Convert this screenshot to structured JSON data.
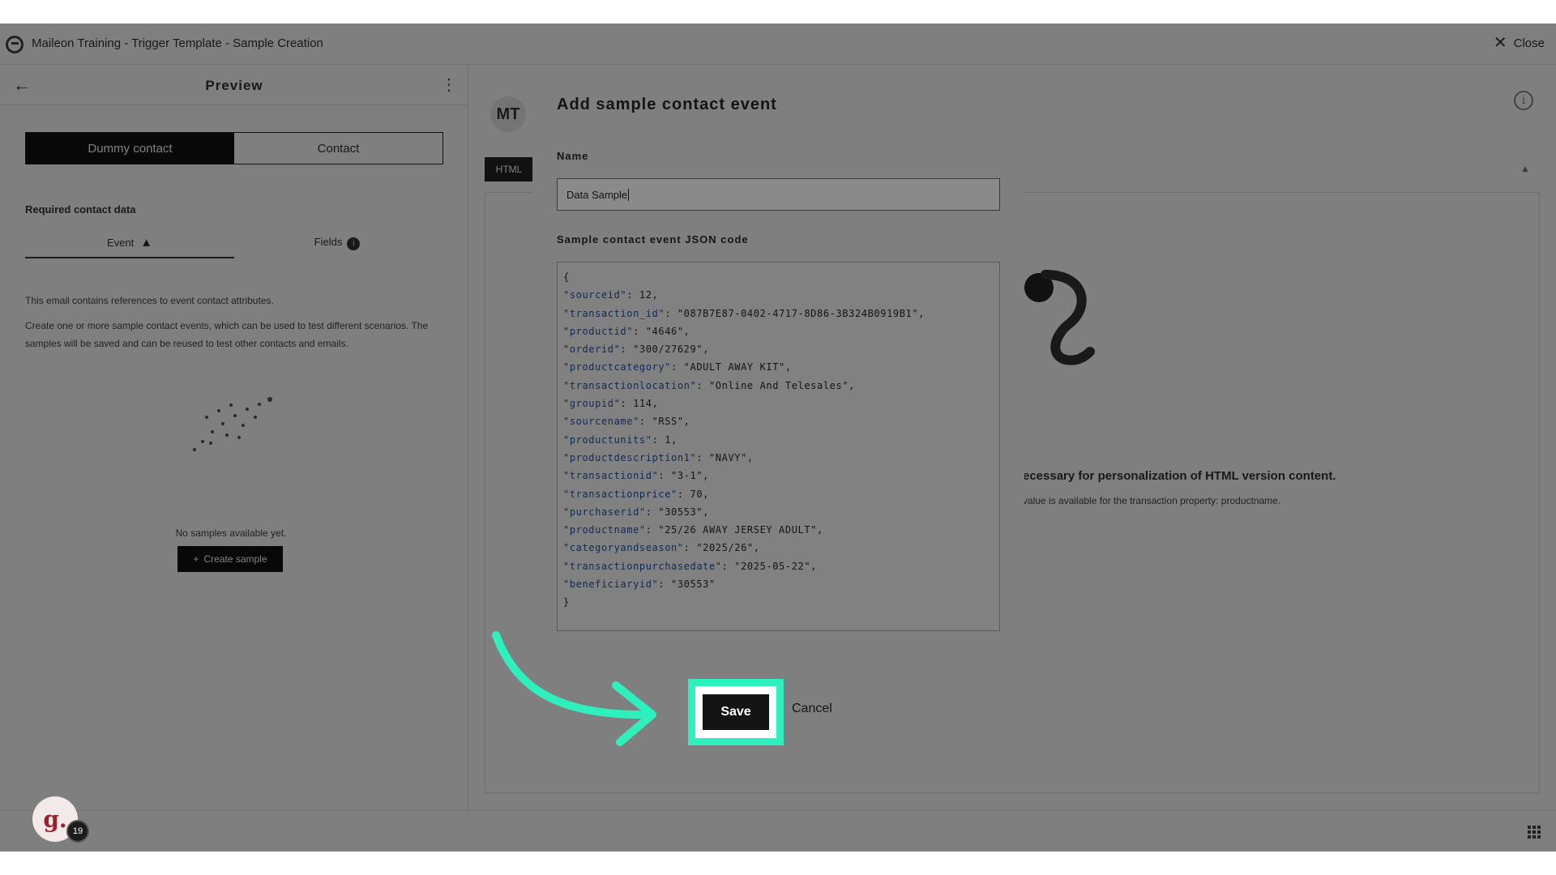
{
  "app": {
    "title": "Maileon Training - Trigger Template - Sample Creation",
    "close_label": "Close"
  },
  "left_panel": {
    "title": "Preview",
    "segment": {
      "active": "Dummy contact",
      "inactive": "Contact"
    },
    "required_label": "Required contact data",
    "tab_event": "Event",
    "tab_fields": "Fields",
    "fields_badge": "i",
    "info_text": "This email contains references to event contact attributes.",
    "desc_text": "Create one or more sample contact events, which can be used to test different scenarios. The samples will be saved and can be reused to test other contacts and emails.",
    "empty_text": "No samples available yet.",
    "create_button": "Create sample"
  },
  "right_area": {
    "avatar_initials": "MT",
    "html_tab": "HTML",
    "message_main": "ecessary for personalization of HTML version content.",
    "message_sub": "value is available for the transaction property: productname."
  },
  "user_avatar": {
    "letter": "g.",
    "badge": "19"
  },
  "modal": {
    "title": "Add sample contact event",
    "name_label": "Name",
    "name_value": "Data Sample",
    "json_label": "Sample contact event JSON code",
    "json_open": "{",
    "json_close": "}",
    "json_lines": [
      {
        "key": "\"sourceid\"",
        "val": " 12,"
      },
      {
        "key": "\"transaction_id\"",
        "val": " \"087B7E87-0402-4717-8D86-3B324B0919B1\","
      },
      {
        "key": "\"productid\"",
        "val": " \"4646\","
      },
      {
        "key": "\"orderid\"",
        "val": " \"300/27629\","
      },
      {
        "key": "\"productcategory\"",
        "val": " \"ADULT AWAY KIT\","
      },
      {
        "key": "\"transactionlocation\"",
        "val": " \"Online And Telesales\","
      },
      {
        "key": "\"groupid\"",
        "val": " 114,"
      },
      {
        "key": "\"sourcename\"",
        "val": " \"RSS\","
      },
      {
        "key": "\"productunits\"",
        "val": " 1,"
      },
      {
        "key": "\"productdescription1\"",
        "val": " \"NAVY\","
      },
      {
        "key": "\"transactionid\"",
        "val": " \"3-1\","
      },
      {
        "key": "\"transactionprice\"",
        "val": " 70,"
      },
      {
        "key": "\"purchaserid\"",
        "val": " \"30553\","
      },
      {
        "key": "\"productname\"",
        "val": " \"25/26 AWAY JERSEY ADULT\","
      },
      {
        "key": "\"categoryandseason\"",
        "val": " \"2025/26\","
      },
      {
        "key": "\"transactionpurchasedate\"",
        "val": " \"2025-05-22\","
      },
      {
        "key": "\"beneficiaryid\"",
        "val": " \"30553\""
      }
    ],
    "save_label": "Save",
    "cancel_label": "Cancel"
  },
  "colors": {
    "highlight": "#2ff0bd",
    "overlay": "#000000",
    "modal_bg": "#7f7f7f",
    "json_key": "#0f2a55"
  },
  "icons": [
    "app-logo-icon",
    "close-icon",
    "back-arrow-icon",
    "kebab-menu-icon",
    "warning-icon",
    "info-icon",
    "plus-icon",
    "grid-icon",
    "chevron-up-icon",
    "callout-arrow-icon"
  ]
}
